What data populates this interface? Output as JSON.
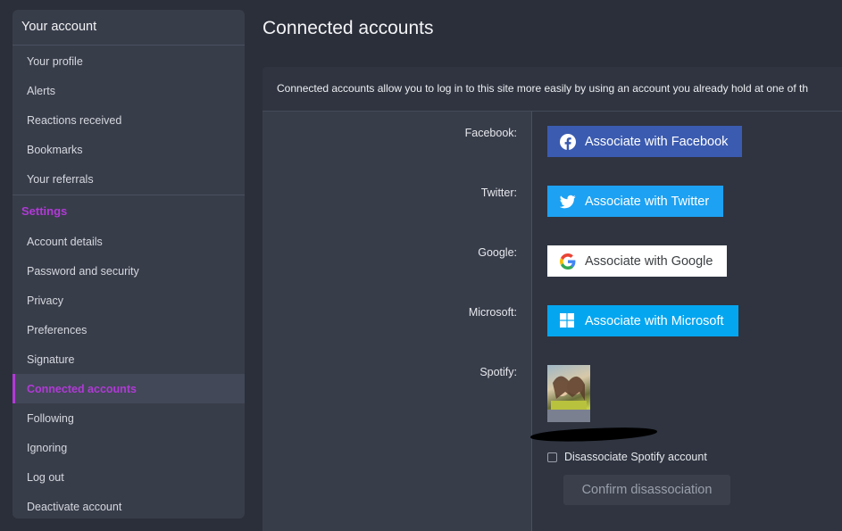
{
  "sidebar": {
    "account_heading": "Your account",
    "account_items": [
      {
        "label": "Your profile"
      },
      {
        "label": "Alerts"
      },
      {
        "label": "Reactions received"
      },
      {
        "label": "Bookmarks"
      },
      {
        "label": "Your referrals"
      }
    ],
    "settings_heading": "Settings",
    "settings_items": [
      {
        "label": "Account details"
      },
      {
        "label": "Password and security"
      },
      {
        "label": "Privacy"
      },
      {
        "label": "Preferences"
      },
      {
        "label": "Signature"
      },
      {
        "label": "Connected accounts",
        "active": true
      },
      {
        "label": "Following"
      },
      {
        "label": "Ignoring"
      },
      {
        "label": "Log out"
      },
      {
        "label": "Deactivate account"
      }
    ],
    "accent_color": "#b03ad6"
  },
  "page": {
    "title": "Connected accounts",
    "intro": "Connected accounts allow you to log in to this site more easily by using an account you already hold at one of th"
  },
  "providers": [
    {
      "label": "Facebook:",
      "button": "Associate with Facebook",
      "icon": "facebook-icon",
      "color": "#3b5bb0"
    },
    {
      "label": "Twitter:",
      "button": "Associate with Twitter",
      "icon": "twitter-icon",
      "color": "#1da1f2"
    },
    {
      "label": "Google:",
      "button": "Associate with Google",
      "icon": "google-icon",
      "color": "#ffffff"
    },
    {
      "label": "Microsoft:",
      "button": "Associate with Microsoft",
      "icon": "windows-icon",
      "color": "#05a6f0"
    }
  ],
  "spotify": {
    "label": "Spotify:",
    "disassociate_label": "Disassociate Spotify account",
    "confirm_button": "Confirm disassociation"
  }
}
